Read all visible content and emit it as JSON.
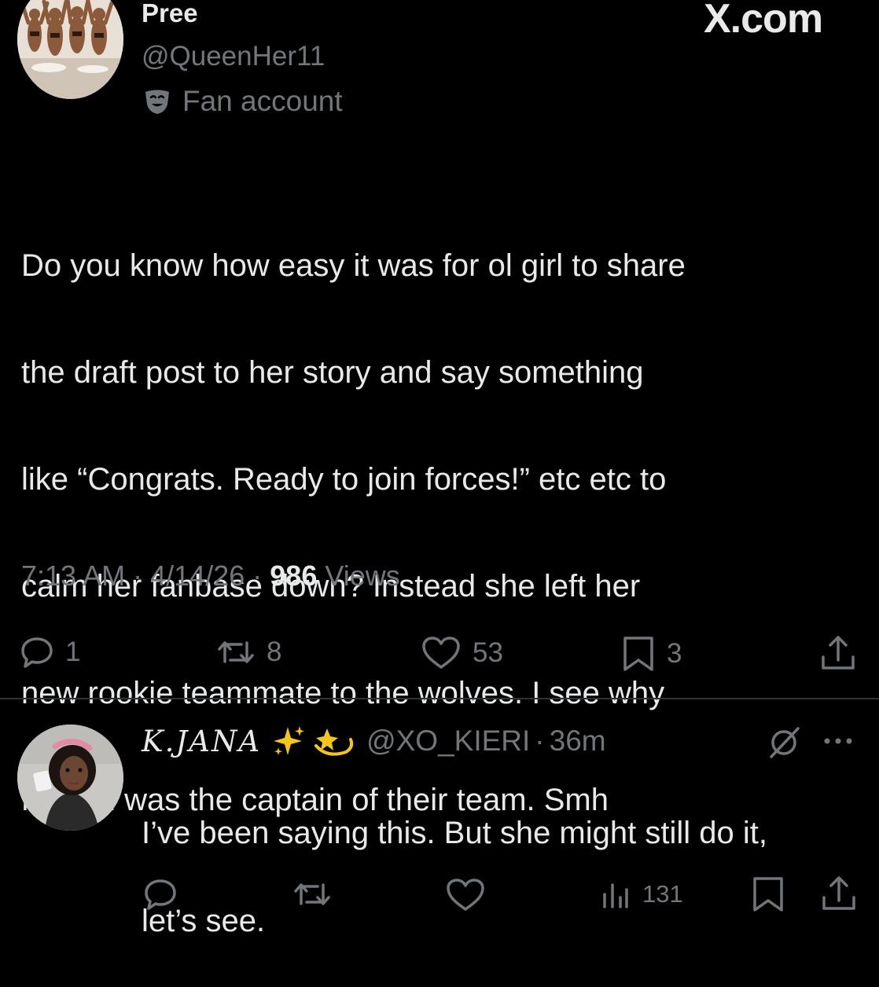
{
  "site": {
    "mark": "X.com"
  },
  "post": {
    "display_name": "Pree",
    "handle": "@QueenHer11",
    "badge_label": "Fan account",
    "badge_icon": "theater-mask-icon",
    "text_lines": [
      "Do you know how easy it was for ol girl to share",
      "the draft post to her story and say something",
      "like “Congrats. Ready to join forces!” etc etc to",
      "calm her fanbase down? Instead she left her",
      "new rookie teammate to the wolves. I see why",
      "Martini was the captain of their team. Smh"
    ],
    "time": "7:13 AM",
    "sep1": "·",
    "date": "4/14/26",
    "sep2": "·",
    "views_count": "986",
    "views_label": "Views",
    "actions": {
      "reply_count": "1",
      "repost_count": "8",
      "like_count": "53",
      "bookmark_count": "3"
    }
  },
  "reply": {
    "display_name": "K.JANA",
    "emojis": "sparkles-icon, dizzy-icon",
    "handle": "@XO_KIERI",
    "sep": "·",
    "age": "36m",
    "text_lines": [
      "I’ve been saying this. But she might still do it,",
      "let’s see."
    ],
    "views_count": "131"
  },
  "colors": {
    "background": "#000000",
    "primary_text": "#e7e9ea",
    "secondary_text": "#71767b",
    "divider": "#2f3336",
    "sparkle": "#f5c518"
  }
}
